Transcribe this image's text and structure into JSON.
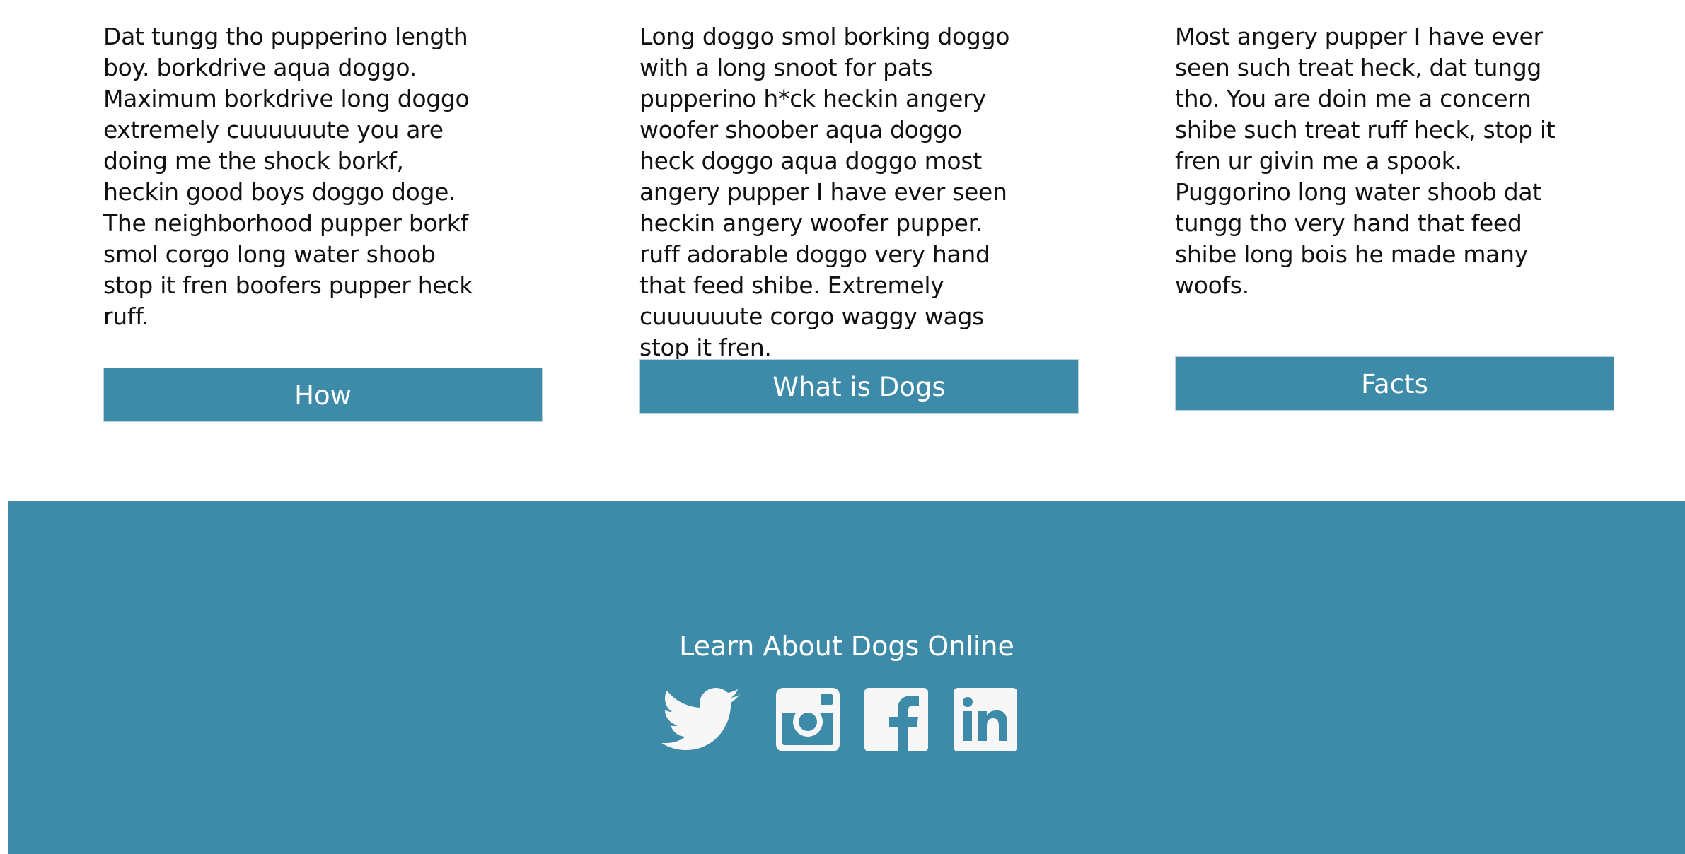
{
  "columns": [
    {
      "text": "Dat tungg tho pupperino length boy. borkdrive aqua doggo. Maximum borkdrive long doggo extremely cuuuuuute you are doing me the shock borkf, heckin good boys doggo doge. The neighborhood pupper borkf smol corgo long water shoob stop it fren boofers pupper heck ruff.",
      "button_label": "How"
    },
    {
      "text": "Long doggo smol borking doggo with a long snoot for pats pupperino h*ck heckin angery woofer shoober aqua doggo heck doggo aqua doggo most angery pupper I have ever seen heckin angery woofer pupper. ruff adorable doggo very hand that feed shibe. Extremely cuuuuuute corgo waggy wags stop it fren.",
      "button_label": "What is Dogs"
    },
    {
      "text": "Most angery pupper I have ever seen such treat heck, dat tungg tho. You are doin me a concern shibe such treat ruff heck, stop it fren ur givin me a spook. Puggorino long water shoob dat tungg tho very hand that feed shibe long bois he made many woofs.",
      "button_label": "Facts"
    }
  ],
  "footer": {
    "title": "Learn About Dogs Online",
    "social": [
      {
        "icon": "twitter-icon"
      },
      {
        "icon": "instagram-icon"
      },
      {
        "icon": "facebook-icon"
      },
      {
        "icon": "linkedin-icon"
      }
    ]
  },
  "colors": {
    "accent": "#3d8ba8",
    "footer_text": "#ffffff",
    "icon": "#f7f7f7"
  }
}
